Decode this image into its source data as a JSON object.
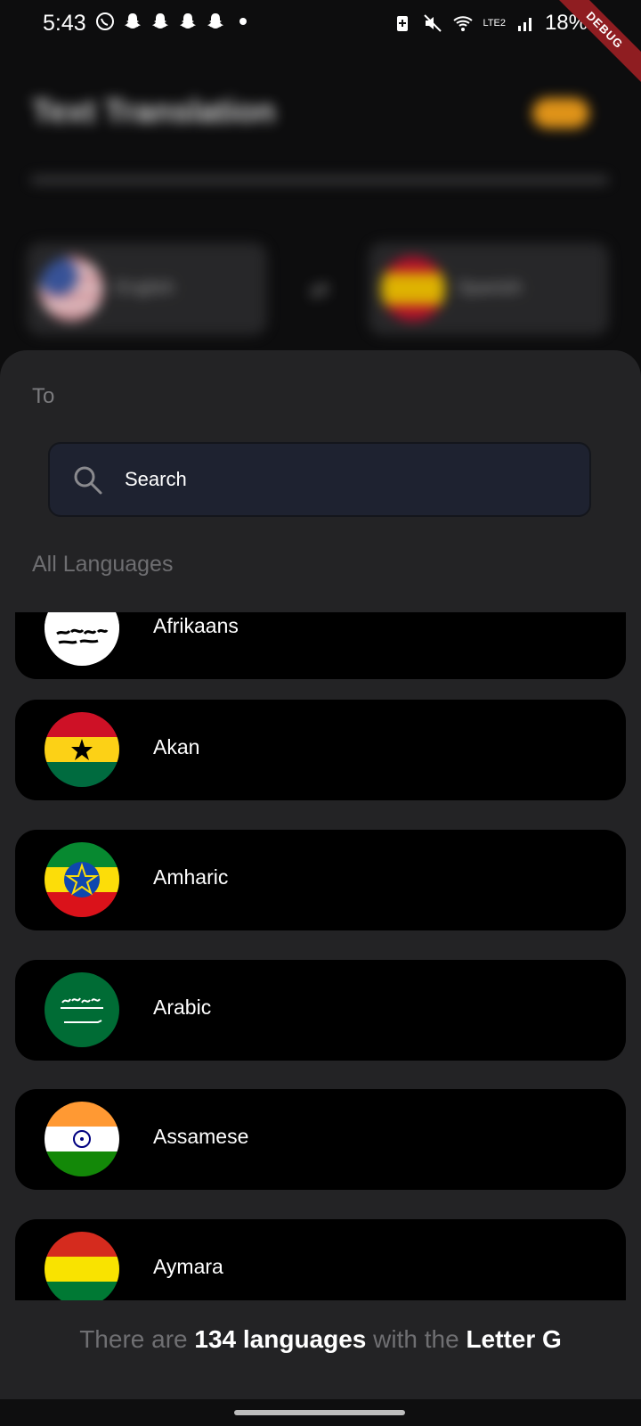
{
  "status_bar": {
    "time": "5:43",
    "battery": "18%",
    "network": "LTE2",
    "left_icons": [
      "whatsapp-icon",
      "snapchat-icon",
      "snapchat-icon",
      "snapchat-icon",
      "snapchat-icon",
      "dot-icon"
    ],
    "right_icons": [
      "battery-saver-icon",
      "mute-icon",
      "wifi-icon",
      "volte-icon",
      "signal-icon"
    ],
    "debug_label": "DEBUG"
  },
  "background_app": {
    "title": "Text Translation",
    "from_language": "English",
    "to_language": "Spanish"
  },
  "sheet": {
    "title": "To",
    "search_placeholder": "Search",
    "section_label": "All Languages",
    "languages": [
      {
        "name": "Afrikaans",
        "flag": "afghanistan-flag"
      },
      {
        "name": "Akan",
        "flag": "ghana-flag"
      },
      {
        "name": "Amharic",
        "flag": "ethiopia-flag"
      },
      {
        "name": "Arabic",
        "flag": "saudi-arabia-flag"
      },
      {
        "name": "Assamese",
        "flag": "india-flag"
      },
      {
        "name": "Aymara",
        "flag": "bolivia-flag"
      }
    ],
    "footer": {
      "prefix": "There are",
      "count": "134 languages",
      "middle": "with the",
      "letter": "Letter G"
    }
  },
  "colors": {
    "sheet_bg": "#232325",
    "item_bg": "#000000",
    "search_bg": "#1e2230",
    "accent_toggle": "#f6a21a"
  }
}
